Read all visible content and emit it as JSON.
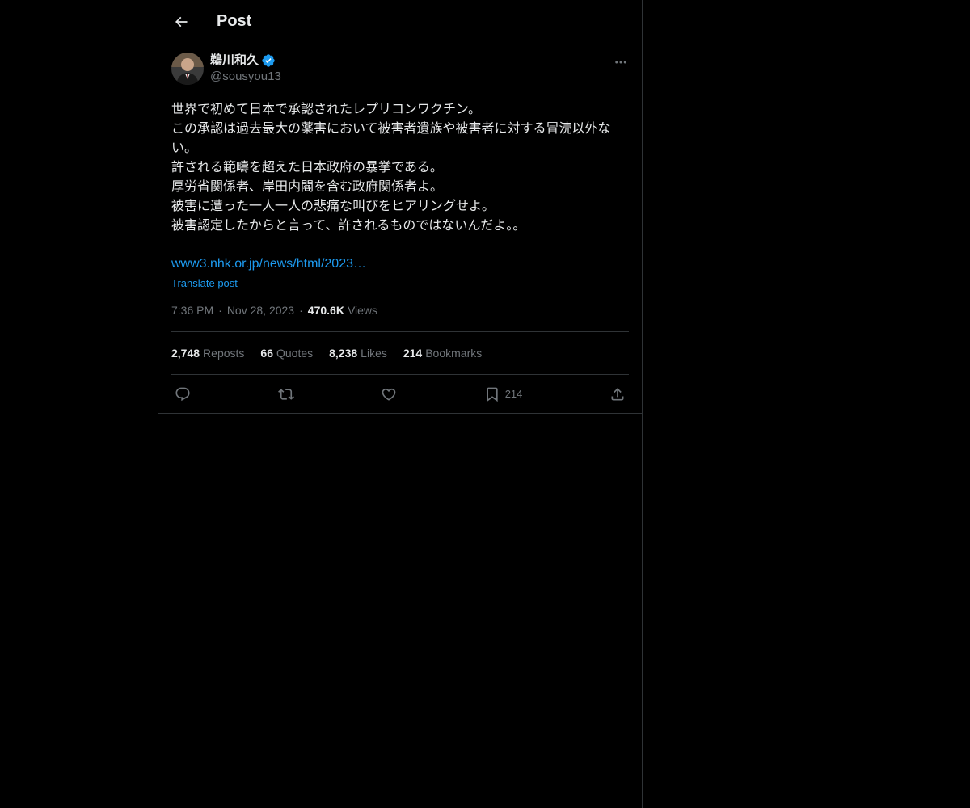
{
  "header": {
    "title": "Post"
  },
  "author": {
    "name": "鵜川和久",
    "handle": "@sousyou13"
  },
  "post": {
    "text": "世界で初めて日本で承認されたレプリコンワクチン。\nこの承認は過去最大の薬害において被害者遺族や被害者に対する冒涜以外ない。\n許される範疇を超えた日本政府の暴挙である。\n厚労省関係者、岸田内閣を含む政府関係者よ。\n被害に遭った一人一人の悲痛な叫びをヒアリングせよ。\n被害認定したからと言って、許されるものではないんだよ。。\n\n",
    "link": "www3.nhk.or.jp/news/html/2023…",
    "translate": "Translate post",
    "time": "7:36 PM",
    "date": "Nov 28, 2023",
    "views_count": "470.6K",
    "views_label": "Views"
  },
  "stats": {
    "reposts_count": "2,748",
    "reposts_label": "Reposts",
    "quotes_count": "66",
    "quotes_label": "Quotes",
    "likes_count": "8,238",
    "likes_label": "Likes",
    "bookmarks_count": "214",
    "bookmarks_label": "Bookmarks"
  },
  "actions": {
    "bookmark_count": "214"
  },
  "colors": {
    "background": "#000000",
    "accent": "#1d9bf0",
    "text_primary": "#e7e9ea",
    "text_secondary": "#71767b",
    "border": "#2f3336"
  },
  "icons": {
    "back": "arrow-left-icon",
    "verified": "verified-badge-icon",
    "more": "more-horizontal-icon",
    "reply": "reply-icon",
    "repost": "repost-icon",
    "like": "heart-icon",
    "bookmark": "bookmark-icon",
    "share": "share-icon"
  }
}
